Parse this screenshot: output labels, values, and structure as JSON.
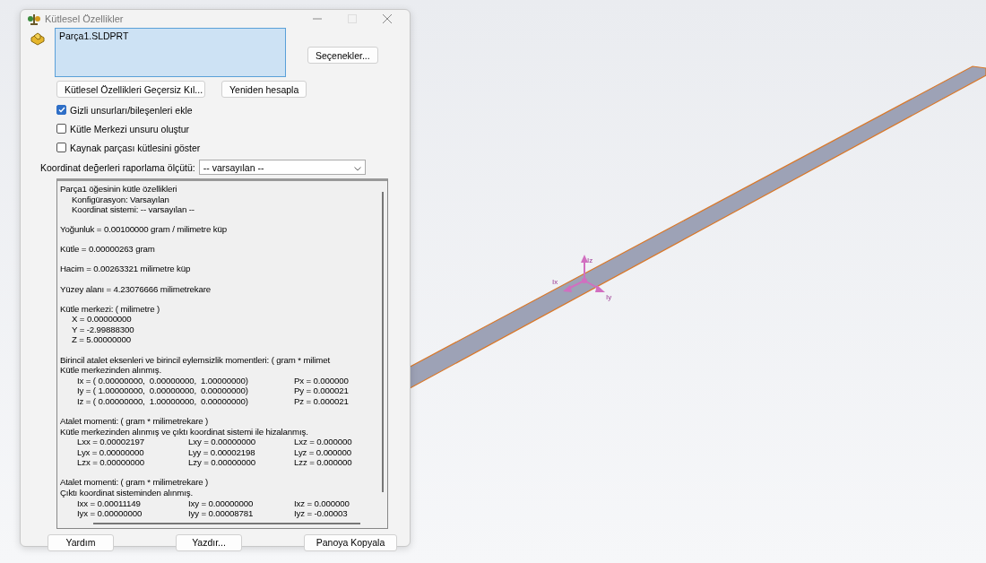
{
  "window": {
    "title": "Kütlesel Özellikler"
  },
  "selection": {
    "items": [
      "Parça1.SLDPRT"
    ]
  },
  "options_button": "Seçenekler...",
  "action_buttons": [
    "Kütlesel Özellikleri Geçersiz Kıl...",
    "Yeniden hesapla"
  ],
  "checkboxes": [
    {
      "label": "Gizli unsurları/bileşenleri ekle",
      "checked": true
    },
    {
      "label": "Kütle Merkezi unsuru oluştur",
      "checked": false
    },
    {
      "label": "Kaynak parçası kütlesini göster",
      "checked": false
    }
  ],
  "coordinate_report": {
    "label": "Koordinat değerleri raporlama ölçütü:",
    "value": "-- varsayılan --"
  },
  "report": {
    "sections": [
      {
        "lines": [
          {
            "kind": "heading",
            "text": "Parça1 öğesinin kütle özellikleri"
          },
          {
            "kind": "detail",
            "text": "Konfigürasyon: Varsayılan"
          },
          {
            "kind": "detail",
            "text": "Koordinat sistemi: -- varsayılan --"
          }
        ]
      },
      {
        "lines": [
          {
            "kind": "heading",
            "text": "Yoğunluk = 0.00100000 gram / milimetre küp"
          }
        ]
      },
      {
        "lines": [
          {
            "kind": "heading",
            "text": "Kütle = 0.00000263 gram"
          }
        ]
      },
      {
        "lines": [
          {
            "kind": "heading",
            "text": "Hacim = 0.00263321 milimetre küp"
          }
        ]
      },
      {
        "lines": [
          {
            "kind": "heading",
            "text": "Yüzey alanı = 4.23076666  milimetrekare"
          }
        ]
      },
      {
        "lines": [
          {
            "kind": "heading",
            "text": "Kütle merkezi: ( milimetre )"
          },
          {
            "kind": "detail",
            "text": "X = 0.00000000"
          },
          {
            "kind": "detail",
            "text": "Y = -2.99888300"
          },
          {
            "kind": "detail",
            "text": "Z = 5.00000000"
          }
        ]
      },
      {
        "lines": [
          {
            "kind": "heading",
            "text": "Birincil atalet eksenleri ve birincil eylemsizlik momentleri: ( gram *  milimet"
          },
          {
            "kind": "heading",
            "text": "Kütle merkezinden alınmış."
          },
          {
            "kind": "columns",
            "cells": [
              "Ix = ( 0.00000000,  0.00000000,  1.00000000)",
              "Px = 0.000000"
            ]
          },
          {
            "kind": "columns",
            "cells": [
              "Iy = ( 1.00000000,  0.00000000,  0.00000000)",
              "Py = 0.000021"
            ]
          },
          {
            "kind": "columns",
            "cells": [
              "Iz = ( 0.00000000,  1.00000000,  0.00000000)",
              "Pz = 0.000021"
            ]
          }
        ]
      },
      {
        "lines": [
          {
            "kind": "heading",
            "text": "Atalet momenti: ( gram *  milimetrekare )"
          },
          {
            "kind": "heading",
            "text": "Kütle merkezinden alınmış ve çıktı koordinat sistemi ile hizalanmış."
          },
          {
            "kind": "columns",
            "cells": [
              "Lxx = 0.00002197",
              "Lxy = 0.00000000",
              "Lxz = 0.000000"
            ]
          },
          {
            "kind": "columns",
            "cells": [
              "Lyx = 0.00000000",
              "Lyy = 0.00002198",
              "Lyz = 0.000000"
            ]
          },
          {
            "kind": "columns",
            "cells": [
              "Lzx = 0.00000000",
              "Lzy = 0.00000000",
              "Lzz = 0.000000"
            ]
          }
        ]
      },
      {
        "lines": [
          {
            "kind": "heading",
            "text": "Atalet momenti: ( gram *  milimetrekare )"
          },
          {
            "kind": "heading",
            "text": "Çıktı koordinat sisteminden alınmış."
          },
          {
            "kind": "columns",
            "cells": [
              "Ixx = 0.00011149",
              "Ixy = 0.00000000",
              "Ixz = 0.000000"
            ]
          },
          {
            "kind": "columns",
            "cells": [
              "Iyx = 0.00000000",
              "Iyy = 0.00008781",
              "Iyz = -0.00003"
            ]
          }
        ]
      }
    ]
  },
  "bottom_buttons": [
    "Yardım",
    "Yazdır...",
    "Panoya Kopyala"
  ],
  "viewport": {
    "triad_labels": [
      "Iz",
      "Ix",
      "Iy"
    ]
  }
}
